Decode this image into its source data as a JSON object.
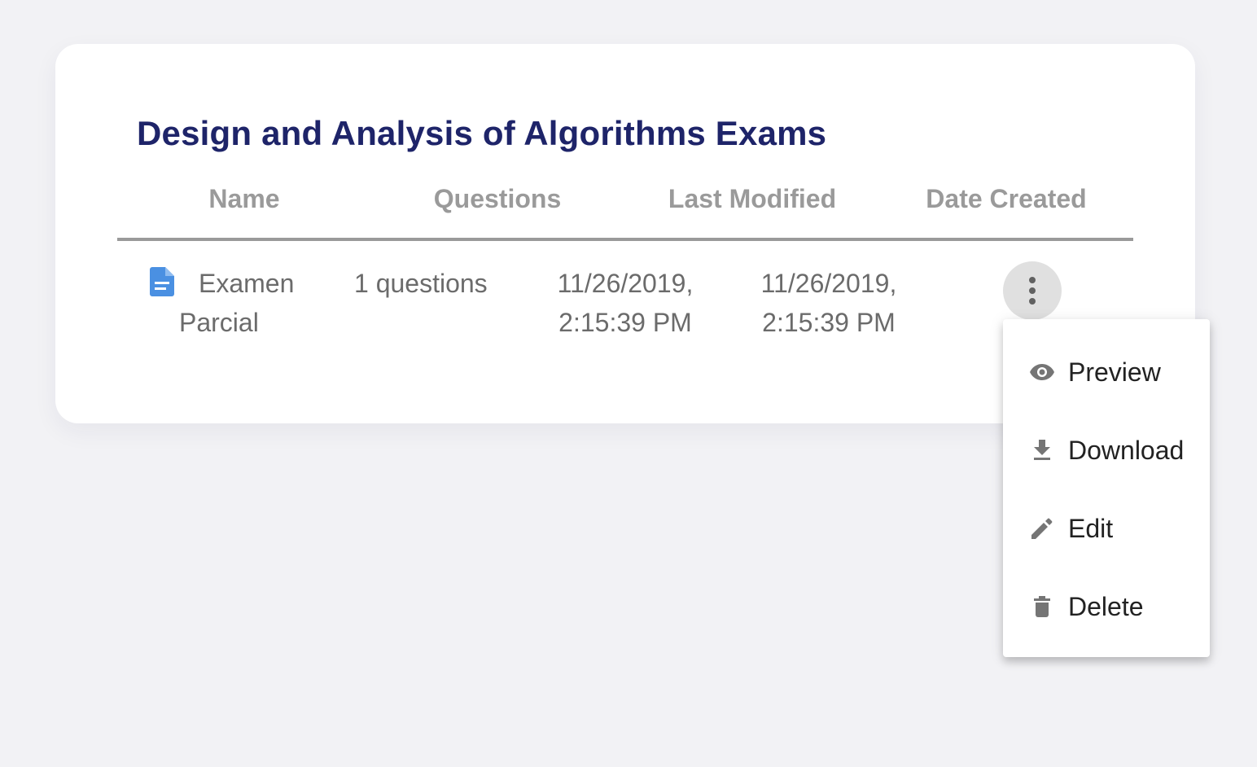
{
  "card": {
    "title": "Design and Analysis of Algorithms Exams",
    "columns": [
      "Name",
      "Questions",
      "Last Modified",
      "Date Created"
    ],
    "rows": [
      {
        "icon": "document-icon",
        "name_line1": "Examen",
        "name_line2": "Parcial",
        "questions": "1 questions",
        "last_modified_date": "11/26/2019,",
        "last_modified_time": "2:15:39 PM",
        "created_date": "11/26/2019,",
        "created_time": "2:15:39 PM",
        "actions_icon": "more-vertical-icon"
      }
    ]
  },
  "menu": {
    "items": [
      {
        "label": "Preview",
        "icon": "eye-icon"
      },
      {
        "label": "Download",
        "icon": "download-icon"
      },
      {
        "label": "Edit",
        "icon": "pencil-icon"
      },
      {
        "label": "Delete",
        "icon": "trash-icon"
      }
    ]
  },
  "colors": {
    "page_bg": "#f2f2f5",
    "title": "#1e2469",
    "header_text": "#9a9a9a",
    "cell_text": "#6b6b6b",
    "doc_icon": "#4a90e2",
    "menu_icon": "#757575"
  }
}
